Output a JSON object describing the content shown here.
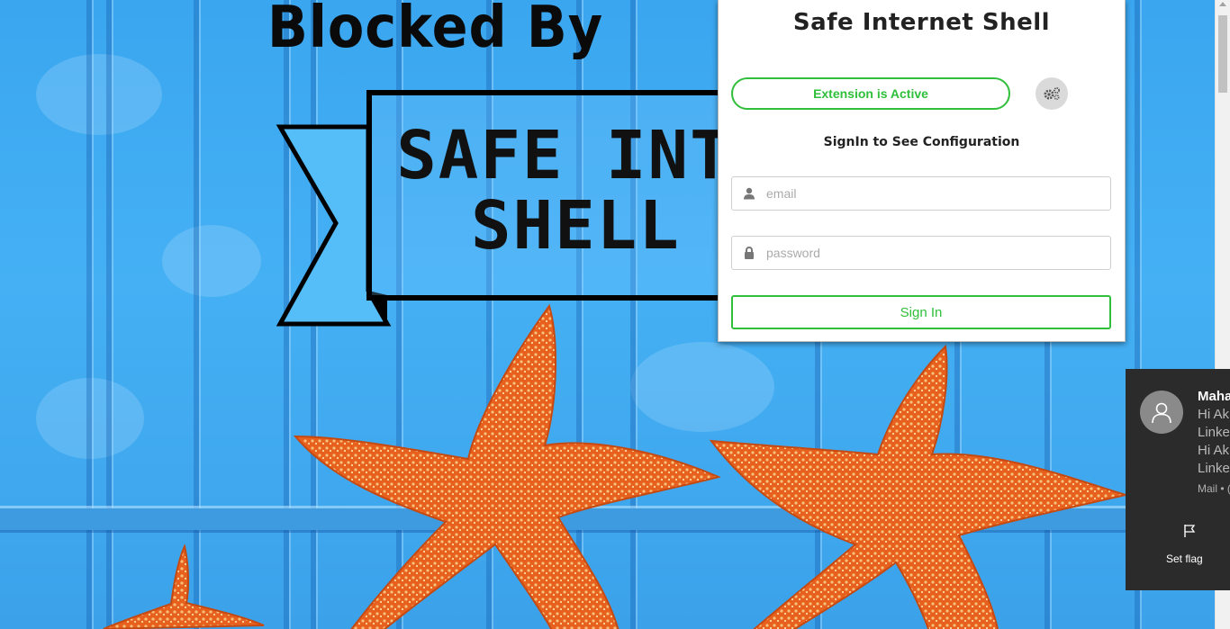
{
  "blocked_page": {
    "heading": "Blocked By",
    "banner_line1": "SAFE INTER",
    "banner_line2": "SHELL"
  },
  "popup": {
    "title": "Safe Internet Shell",
    "status_label": "Extension is Active",
    "settings_icon": "gears-icon",
    "signin_heading": "SignIn to See Configuration",
    "email": {
      "value": "",
      "placeholder": "email",
      "icon": "user-icon"
    },
    "password": {
      "value": "",
      "placeholder": "password",
      "icon": "lock-icon"
    },
    "signin_button": "Sign In",
    "accent_color": "#2fbf3a"
  },
  "notification": {
    "sender": "Maha",
    "lines": [
      "Hi Ak",
      "Linked",
      "Hi Ak",
      "Linked"
    ],
    "meta": "Mail • (",
    "flag_icon": "flag-icon",
    "flag_label": "Set flag",
    "background_color": "#2b2b2b"
  }
}
